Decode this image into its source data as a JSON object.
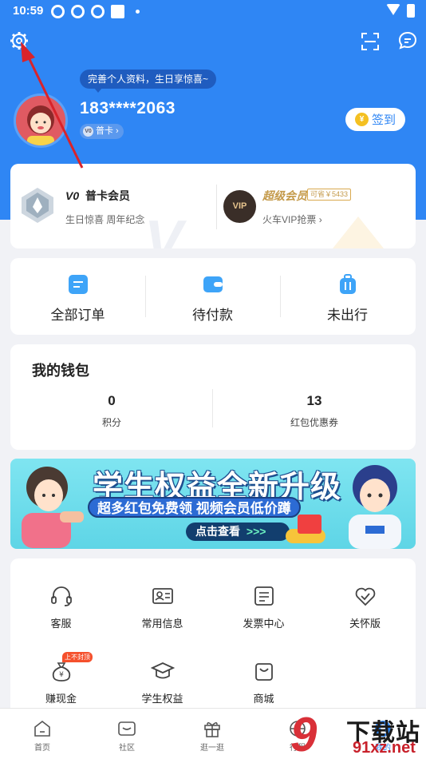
{
  "status_bar": {
    "time": "10:59"
  },
  "header": {
    "tooltip": "完善个人资料，生日享惊喜~",
    "phone": "183****2063",
    "member_badge": "普卡",
    "member_badge_icon": "V0",
    "checkin_label": "签到",
    "checkin_coin": "¥"
  },
  "membership": {
    "left": {
      "title": "普卡会员",
      "title_prefix": "V0",
      "subtitle": "生日惊喜  周年纪念"
    },
    "right": {
      "title": "超级会员",
      "save_tag": "可省￥5433",
      "subtitle": "火车VIP抢票",
      "icon_text": "VIP"
    }
  },
  "orders": [
    {
      "label": "全部订单",
      "icon": "list-icon"
    },
    {
      "label": "待付款",
      "icon": "wallet-icon"
    },
    {
      "label": "未出行",
      "icon": "luggage-icon"
    }
  ],
  "wallet": {
    "title": "我的钱包",
    "items": [
      {
        "value": "0",
        "label": "积分"
      },
      {
        "value": "13",
        "label": "红包优惠券"
      }
    ]
  },
  "banner": {
    "headline": "学生权益全新升级",
    "subline": "超多红包免费领 视频会员低价蹲",
    "button": "点击查看",
    "button_arrows": ">>>"
  },
  "services": [
    {
      "label": "客服",
      "icon": "headset-icon"
    },
    {
      "label": "常用信息",
      "icon": "id-card-icon"
    },
    {
      "label": "发票中心",
      "icon": "invoice-icon"
    },
    {
      "label": "关怀版",
      "icon": "heart-check-icon"
    },
    {
      "label": "赚现金",
      "icon": "money-bag-icon",
      "tag": "上不封顶"
    },
    {
      "label": "学生权益",
      "icon": "graduation-cap-icon"
    },
    {
      "label": "商城",
      "icon": "shopping-bag-icon"
    }
  ],
  "bottom_nav": [
    {
      "label": "首页",
      "icon": "home-icon"
    },
    {
      "label": "社区",
      "icon": "community-icon"
    },
    {
      "label": "逛一逛",
      "icon": "gift-icon"
    },
    {
      "label": "行程",
      "icon": "trip-icon"
    },
    {
      "label": "我的",
      "icon": "profile-icon"
    }
  ],
  "watermark": {
    "title": "下载站",
    "url": "91xz.net",
    "number": "9"
  },
  "colors": {
    "primary": "#2f86f4",
    "gold": "#c49a4a",
    "annotation_arrow": "#d9232a"
  }
}
